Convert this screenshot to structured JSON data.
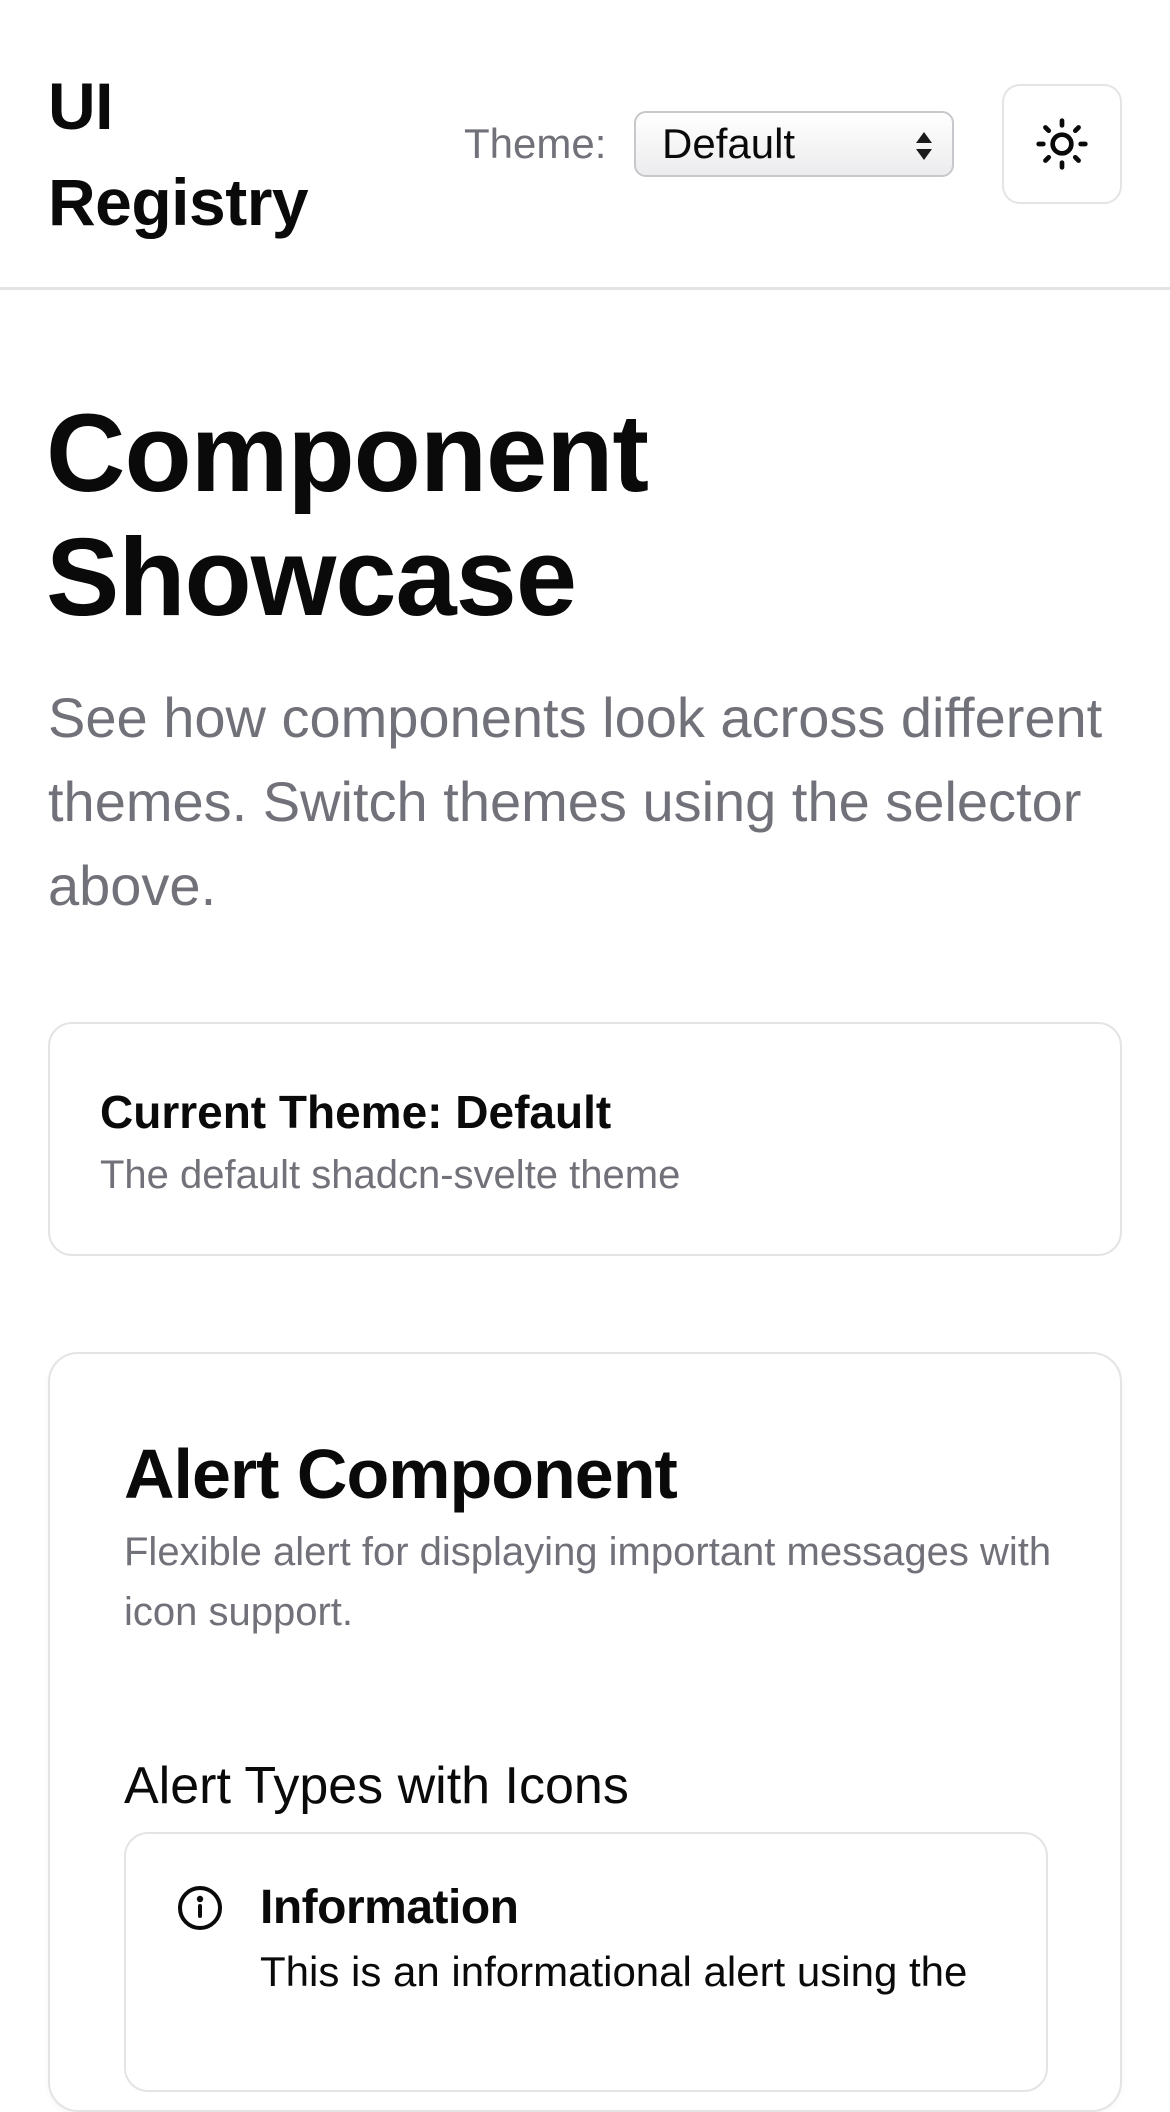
{
  "header": {
    "brand": "UI Registry",
    "theme_label": "Theme:",
    "theme_select": {
      "value": "Default"
    },
    "theme_toggle_icon": "sun-icon"
  },
  "hero": {
    "title": "Component Showcase",
    "subtitle": "See how components look across different themes. Switch themes using the selector above."
  },
  "current_theme_card": {
    "title": "Current Theme: Default",
    "description": "The default shadcn-svelte theme"
  },
  "alert_section": {
    "title": "Alert Component",
    "description": "Flexible alert for displaying important messages with icon support.",
    "subsection_title": "Alert Types with Icons",
    "alerts": [
      {
        "icon": "info-icon",
        "title": "Information",
        "text": "This is an informational alert using the"
      }
    ]
  },
  "colors": {
    "border": "#e4e4e7",
    "muted_text": "#71717a",
    "foreground": "#0a0a0a",
    "background": "#ffffff"
  }
}
